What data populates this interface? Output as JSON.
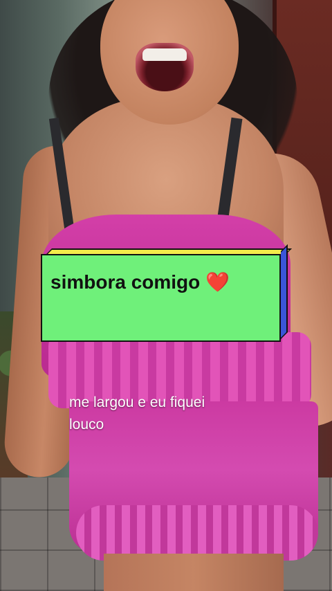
{
  "sticker": {
    "text": "simbora comigo",
    "emoji_icon": "red-heart-icon",
    "emoji_char": "❤️",
    "colors": {
      "face": "#6ff07a",
      "top": "#f4ea4a",
      "side": "#3b55d8",
      "border": "#111111"
    }
  },
  "caption": {
    "line1": "me largou e eu fiquei",
    "line2": "louco"
  }
}
